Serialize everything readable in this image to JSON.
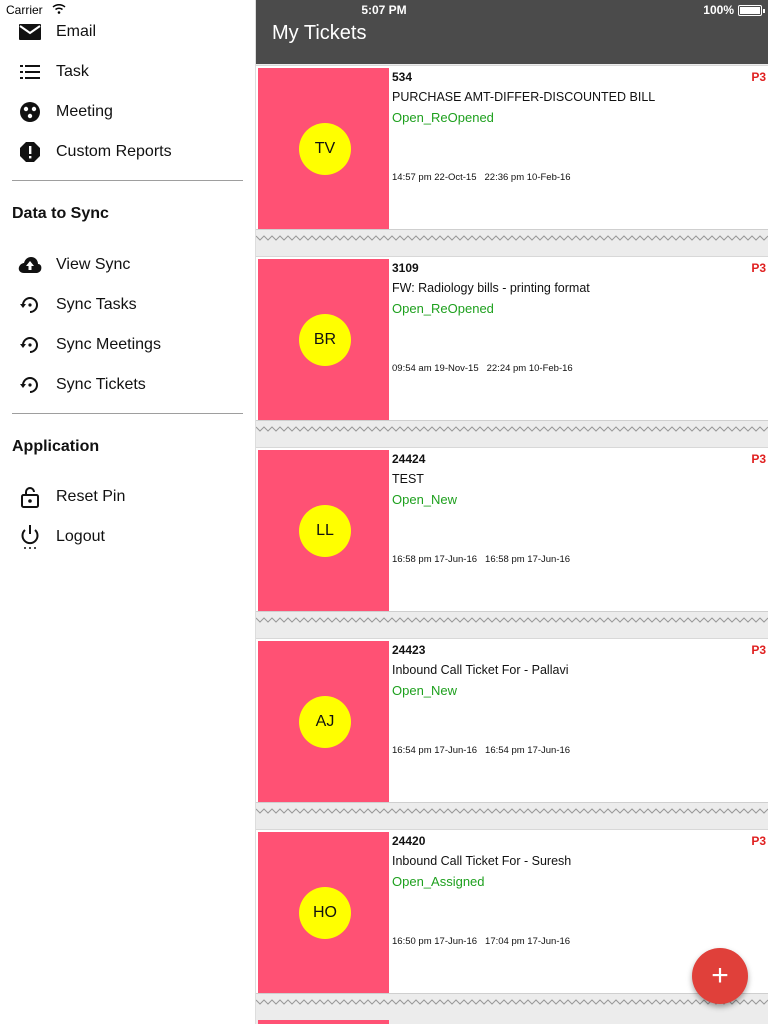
{
  "status_bar": {
    "carrier": "Carrier",
    "time": "5:07 PM",
    "battery": "100%"
  },
  "drawer": {
    "items_top": [
      {
        "label": "Email",
        "icon": "mail-icon"
      },
      {
        "label": "Task",
        "icon": "list-icon"
      },
      {
        "label": "Meeting",
        "icon": "meeting-icon"
      },
      {
        "label": "Custom Reports",
        "icon": "report-icon"
      }
    ],
    "section_sync": "Data to Sync",
    "items_sync": [
      {
        "label": "View Sync",
        "icon": "cloud-upload-icon"
      },
      {
        "label": "Sync Tasks",
        "icon": "sync-history-icon"
      },
      {
        "label": "Sync Meetings",
        "icon": "sync-history-icon"
      },
      {
        "label": "Sync Tickets",
        "icon": "sync-history-icon"
      }
    ],
    "section_app": "Application",
    "items_app": [
      {
        "label": "Reset Pin",
        "icon": "lock-icon"
      },
      {
        "label": "Logout",
        "icon": "power-icon"
      }
    ]
  },
  "app_bar": {
    "title": "My Tickets"
  },
  "tickets": [
    {
      "initials": "TV",
      "id": "534",
      "priority": "P3",
      "subject": "PURCHASE AMT-DIFFER-DISCOUNTED BILL",
      "status": "Open_ReOpened",
      "created": "14:57 pm 22-Oct-15",
      "updated": "22:36 pm 10-Feb-16"
    },
    {
      "initials": "BR",
      "id": "3109",
      "priority": "P3",
      "subject": "FW: Radiology bills - printing format",
      "status": "Open_ReOpened",
      "created": "09:54 am 19-Nov-15",
      "updated": "22:24 pm 10-Feb-16"
    },
    {
      "initials": "LL",
      "id": "24424",
      "priority": "P3",
      "subject": "TEST",
      "status": "Open_New",
      "created": "16:58 pm 17-Jun-16",
      "updated": "16:58 pm 17-Jun-16"
    },
    {
      "initials": "AJ",
      "id": "24423",
      "priority": "P3",
      "subject": "Inbound Call Ticket For - Pallavi",
      "status": "Open_New",
      "created": "16:54 pm 17-Jun-16",
      "updated": "16:54 pm 17-Jun-16"
    },
    {
      "initials": "HO",
      "id": "24420",
      "priority": "P3",
      "subject": "Inbound Call Ticket For - Suresh",
      "status": "Open_Assigned",
      "created": "16:50 pm 17-Jun-16",
      "updated": "17:04 pm 17-Jun-16"
    }
  ],
  "fab": {
    "label": "+"
  },
  "colors": {
    "app_bar": "#4b4b4b",
    "thumb": "#ff5174",
    "avatar": "#ffff00",
    "status_green": "#1ea01e",
    "priority_red": "#e02020",
    "fab": "#e0403a"
  }
}
